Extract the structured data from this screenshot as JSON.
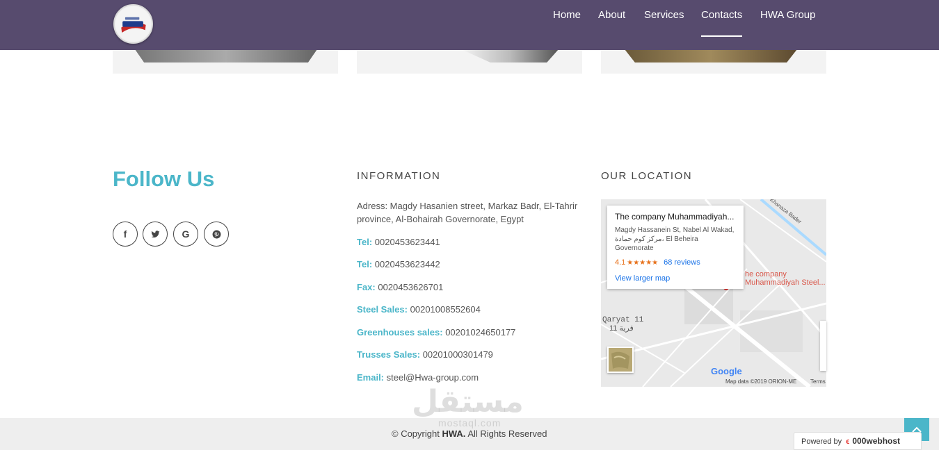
{
  "header": {
    "nav": [
      {
        "label": "Home",
        "active": false
      },
      {
        "label": "About",
        "active": false
      },
      {
        "label": "Services",
        "active": false
      },
      {
        "label": "Contacts",
        "active": true
      },
      {
        "label": "HWA Group",
        "active": false
      }
    ],
    "colors": {
      "background": "#574b6e",
      "text": "#ffffff"
    }
  },
  "follow": {
    "title": "Follow Us",
    "social": [
      {
        "icon": "facebook-icon",
        "glyph": "f"
      },
      {
        "icon": "twitter-icon"
      },
      {
        "icon": "google-icon",
        "glyph": "G"
      },
      {
        "icon": "pinterest-icon"
      }
    ]
  },
  "information": {
    "heading": "INFORMATION",
    "address": "Adress: Magdy Hasanien street, Markaz Badr, El-Tahrir province, Al-Bohairah Governorate, Egypt",
    "contacts": [
      {
        "label": "Tel:",
        "value": "0020453623441"
      },
      {
        "label": "Tel:",
        "value": "0020453623442"
      },
      {
        "label": "Fax:",
        "value": "0020453626701"
      },
      {
        "label": "Steel Sales:",
        "value": "00201008552604"
      },
      {
        "label": "Greenhouses sales:",
        "value": "00201024650177"
      },
      {
        "label": "Trusses Sales:",
        "value": "00201000301479"
      },
      {
        "label": "Email:",
        "value": "steel@Hwa-group.com"
      }
    ]
  },
  "location": {
    "heading": "OUR LOCATION",
    "map": {
      "place_title": "The company Muhammadiyah...",
      "place_address": "Magdy Hassanein St, Nabel Al Wakad, مركز كوم حمادة، El Beheira Governorate",
      "rating": "4.1",
      "stars": "★★★★★",
      "reviews": "68 reviews",
      "larger_map": "View larger map",
      "pin_label_1": "he company",
      "pin_label_2": "Muhammadiyah Steel...",
      "village": "Qaryat 11",
      "village_ar": "قرية 11",
      "road": "Khanaza Bader",
      "google": "Google",
      "map_data": "Map data ©2019 ORION-ME",
      "terms": "Terms"
    }
  },
  "watermark": {
    "text": "مستقل",
    "sub": "mostaql.com"
  },
  "footer": {
    "copyright_prefix": "© Copyright",
    "brand": "HWA.",
    "copyright_suffix": "All Rights Reserved",
    "powered_by": "Powered by",
    "host": "000webhost"
  },
  "colors": {
    "accent": "#4bb6c9",
    "footer_bg": "#eeeeee"
  }
}
